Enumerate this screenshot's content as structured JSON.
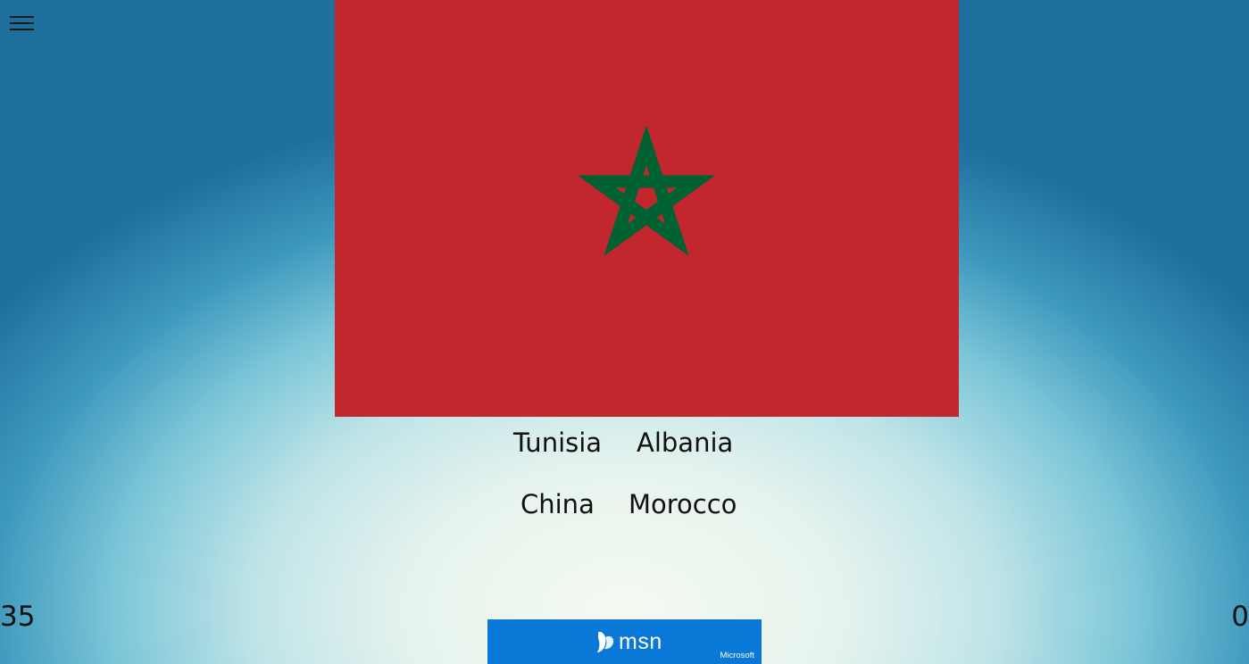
{
  "menu": {
    "icon": "hamburger-menu-icon"
  },
  "flag": {
    "icon": "flag-of-morocco",
    "field_color": "#c1272d",
    "star_color": "#006233"
  },
  "answers": [
    {
      "label": "Tunisia"
    },
    {
      "label": "Albania"
    },
    {
      "label": "China"
    },
    {
      "label": "Morocco"
    }
  ],
  "counters": {
    "left": "35",
    "right": "0"
  },
  "ad": {
    "brand": "msn",
    "company": "Microsoft",
    "icon": "msn-butterfly-icon",
    "background": "#0a78d7"
  }
}
